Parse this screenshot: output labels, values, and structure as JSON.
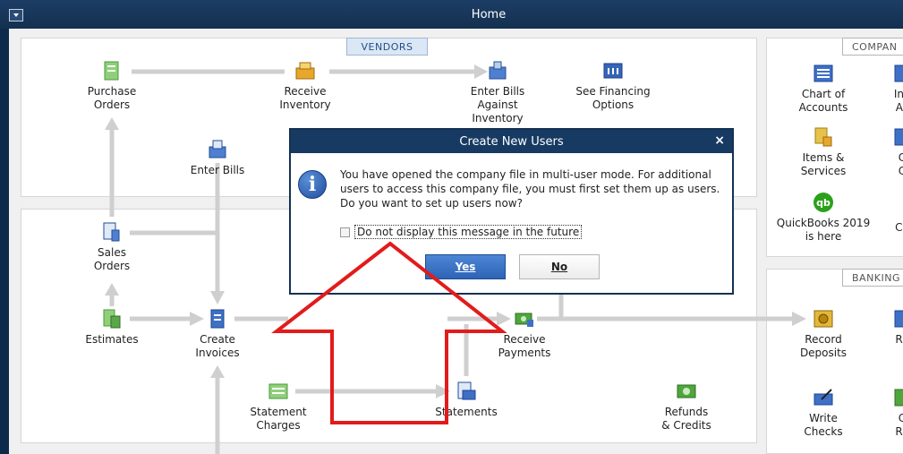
{
  "window": {
    "title": "Home"
  },
  "sections": {
    "vendors": "VENDORS",
    "company": "COMPAN",
    "banking": "BANKING"
  },
  "workflow": {
    "purchase_orders": "Purchase\nOrders",
    "receive_inventory": "Receive\nInventory",
    "enter_bills_against_inventory": "Enter Bills\nAgainst\nInventory",
    "see_financing_options": "See Financing\nOptions",
    "enter_bills": "Enter Bills",
    "sales_orders": "Sales\nOrders",
    "estimates": "Estimates",
    "create_invoices": "Create\nInvoices",
    "receive_payments": "Receive\nPayments",
    "statement_charges": "Statement\nCharges",
    "statements": "Statements",
    "refunds_credits": "Refunds\n& Credits"
  },
  "company": {
    "chart_of_accounts": "Chart of\nAccounts",
    "items_services": "Items &\nServices",
    "quickbooks_here": "QuickBooks 2019\nis here",
    "inv_partial": "Inv\nAc",
    "c_partial_1": "C\nC",
    "ca_partial": "Ca"
  },
  "banking": {
    "record_deposits": "Record\nDeposits",
    "write_checks": "Write\nChecks",
    "re_partial_1": "Re",
    "re_partial_2": "C\nRe"
  },
  "dialog": {
    "title": "Create New Users",
    "close": "×",
    "message": "You have opened the company file in multi-user mode. For additional users to access this company file, you must first set them up as users. Do you want to set up users now?",
    "checkbox_label": "Do not display this message in the future",
    "yes": "Yes",
    "no": "No"
  },
  "colors": {
    "title_bar": "#173a63",
    "arrow": "#e21b1b",
    "flow_line": "#cfcfcf"
  }
}
